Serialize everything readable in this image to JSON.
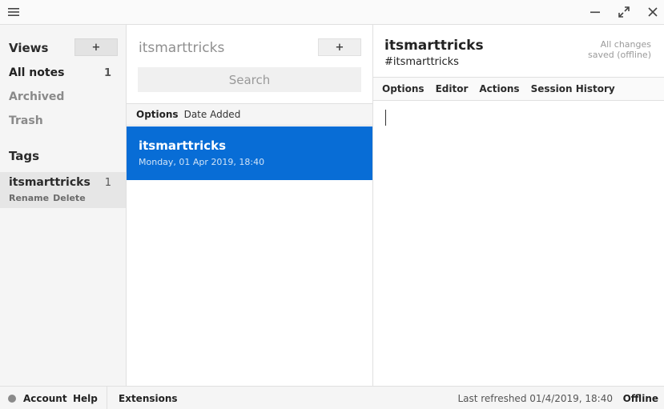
{
  "window": {
    "controls": {
      "menu_icon": "hamburger-menu-icon",
      "minimize_icon": "minimize-icon",
      "maximize_icon": "maximize-icon",
      "close_icon": "close-icon"
    }
  },
  "views": {
    "title": "Views",
    "add_label": "+",
    "items": [
      {
        "label": "All notes",
        "count": "1"
      },
      {
        "label": "Archived",
        "count": ""
      },
      {
        "label": "Trash",
        "count": ""
      }
    ]
  },
  "tags": {
    "title": "Tags",
    "items": [
      {
        "name": "itsmarttricks",
        "count": "1",
        "rename_label": "Rename",
        "delete_label": "Delete"
      }
    ]
  },
  "notes": {
    "title": "itsmarttricks",
    "add_label": "+",
    "search_placeholder": "Search",
    "sort_options_label": "Options",
    "sort_value": "Date Added",
    "items": [
      {
        "title": "itsmarttricks",
        "date": "Monday, 01 Apr 2019, 18:40",
        "selected": true
      }
    ],
    "selected_color": "#086dd6"
  },
  "editor": {
    "title": "itsmarttricks",
    "tags": "#itsmarttricks",
    "save_status": "All changes saved (offline)",
    "menu": [
      "Options",
      "Editor",
      "Actions",
      "Session History"
    ]
  },
  "footer": {
    "account_label": "Account",
    "help_label": "Help",
    "extensions_label": "Extensions",
    "last_refreshed": "Last refreshed 01/4/2019, 18:40",
    "status": "Offline"
  }
}
